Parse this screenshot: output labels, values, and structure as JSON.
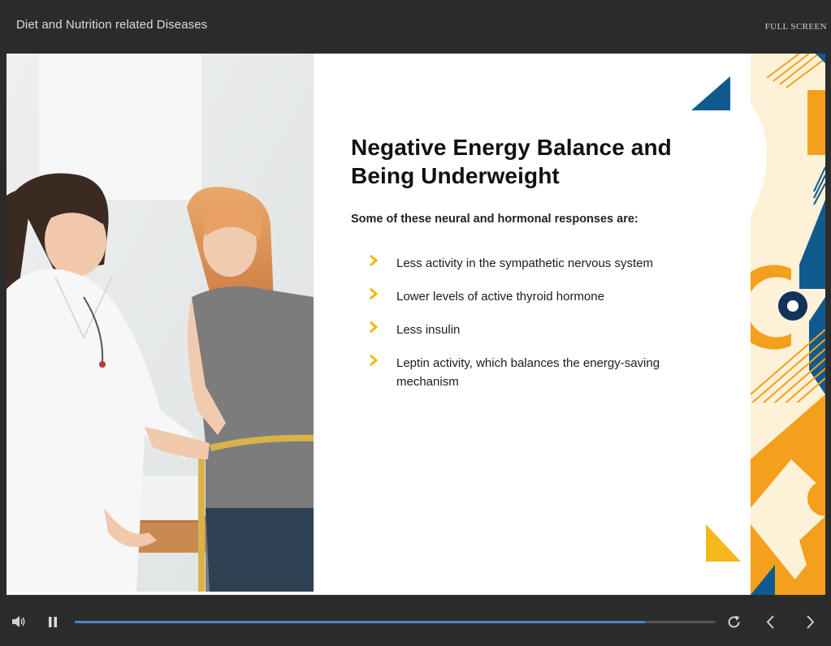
{
  "player": {
    "course_title": "Diet and Nutrition related Diseases",
    "fullscreen_label": "FULL SCREEN"
  },
  "slide": {
    "title": "Negative Energy Balance and Being Underweight",
    "subtitle": "Some of these neural and hormonal responses are:",
    "bullets": [
      "Less activity in the sympathetic nervous system",
      "Lower levels of active thyroid hormone",
      "Less insulin",
      "Leptin activity, which balances the energy-saving mechanism"
    ],
    "image_subject": "doctor measuring waist of young woman with tape measure",
    "bullet_icon": "chevron-right-icon"
  },
  "controls": {
    "volume_icon": "volume-icon",
    "pause_icon": "pause-icon",
    "replay_icon": "replay-icon",
    "prev_icon": "chevron-left-icon",
    "next_icon": "chevron-right-icon",
    "progress": 0.89
  },
  "colors": {
    "accent_yellow": "#f2b705",
    "accent_orange": "#f4a01c",
    "accent_blue": "#0f5a8e",
    "progress": "#4b86c6",
    "chrome_bg": "#2b2b2b"
  }
}
